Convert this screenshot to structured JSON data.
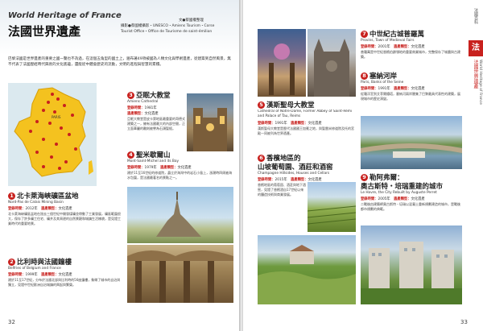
{
  "left": {
    "en_title": "World Heritage of France",
    "zh_title": "法國世界遺產",
    "credit_line1": "文●蔡國權整理",
    "credit_line2": "攝影●蔡國權攝影・UNESCO・Amiens Tourism・Corse",
    "credit_line3": "Tourist Office・Office de Tourisme de saint-émilion",
    "intro": "巴黎法國是世界遺產的重要之國一覽也不為過，在這個五角型的國土上，遍布著49項被國為人類文化與學術遺產，從建築到自然風景，無不代表了法國歷經時代興衰的文化底蘊，還能從中體會歷史的流動，文明的進程與智慧的累積。",
    "items": [
      {
        "num": "1",
        "zh": "北卡萊海峽礦區盆地",
        "en": "Nord-Pas de Calais Mining Basin",
        "year_label": "登錄時間：",
        "year": "2012年",
        "type_label": "遺產類型：",
        "type": "文化遺產",
        "text": "北卡萊海峽礦區盆地在過去三個世紀中開發煤礦並帶動了工業發展，礦區範圍很大，保存了許多礦工住宅、礦井及其周邊的自然景觀和城鎮生活樣貌，是見證工業時代的重要地景。"
      },
      {
        "num": "2",
        "zh": "比利時與法國鐘樓",
        "en": "Belfries of Belgium and France",
        "year_label": "登錄時間：",
        "year": "1999年",
        "type_label": "遺產類型：",
        "type": "文化遺產",
        "text": "建於11至17世紀，分布於法國北部與比利時的56座鐘樓，象徵了城市的自治與獨立，見證中世紀歐洲自治城鎮的興起與繁榮。"
      },
      {
        "num": "3",
        "zh": "亞眠大教堂",
        "en": "Amiens Cathedral",
        "year_label": "登錄時間：",
        "year": "1981年",
        "type_label": "遺產類型：",
        "type": "文化遺產",
        "text": "亞眠大教堂是皮卡第地區最重要的哥德式建築之一，擁有法國最大的內部空間，正立面華麗的雕刻被譽為石頭聖經。"
      },
      {
        "num": "4",
        "zh": "聖米歇爾山",
        "en": "Mont-Saint-Michel and its Bay",
        "year_label": "登錄時間：",
        "year": "1979年",
        "type_label": "遺產類型：",
        "type": "文化遺產",
        "text": "建於11至16世紀的修道院，矗立於海灣中的岩石小島上，漲潮時四周被海水包圍，是法國最著名的景點之一。"
      },
      {
        "num": "5",
        "zh": "漢斯聖母大教堂",
        "en": "Cathedral of Notre-Dame, Former Abbey of Saint-Rémi and Palace of Tau, Reims",
        "year_label": "登錄時間：",
        "year": "1991年",
        "type_label": "遺產類型：",
        "type": "文化遺產",
        "text": "漢斯聖母大教堂是歷代法國國王加冕之地，與聖雷米修道院及托的宮殿一同被列為世界遺產。"
      },
      {
        "num": "6",
        "zh": "香檳地區的山坡葡萄園、酒莊和酒窖",
        "zh1": "香檳地區的",
        "zh2": "山坡葡萄園、酒莊和酒窖",
        "en": "Champagne Hillsides, Houses and Cellars",
        "year_label": "登錄時間：",
        "year": "2015年",
        "type_label": "遺產類型：",
        "type": "文化遺產",
        "text": "香檳地區的葡萄園、酒莊與地下酒窖，見證了香檳酒自17世紀以來的釀造技術與商業發展。"
      },
      {
        "num": "7",
        "zh": "中世紀古城普羅萬",
        "en": "Provins, Town of Medieval Fairs",
        "year_label": "登錄時間：",
        "year": "2001年",
        "type_label": "遺產類型：",
        "type": "文化遺產",
        "text": "普羅萬是中世紀香檳伯爵領地的重要商業城市，完整保存了城牆與古建築。"
      },
      {
        "num": "8",
        "zh": "塞納河岸",
        "en": "Paris, Banks of the Seine",
        "year_label": "登錄時間：",
        "year": "1991年",
        "type_label": "遺產類型：",
        "type": "文化遺產",
        "text": "從羅浮宮到艾菲爾鐵塔，塞納河兩岸匯集了巴黎最具代表性的建築，展現城市的歷史演變。"
      },
      {
        "num": "9",
        "zh": "勒阿弗爾：奧古斯特・培瑞重建的城市",
        "zh1": "勒阿弗爾：",
        "zh2": "奧古斯特・培瑞重建的城市",
        "en": "Le Havre, the City Rebuilt by Auguste Perret",
        "year_label": "登錄時間：",
        "year": "2005年",
        "type_label": "遺產類型：",
        "type": "文化遺產",
        "text": "二戰後由建築師奧古斯特・培瑞以混凝土重新規劃建造的城市，是戰後都市規劃的典範。"
      }
    ],
    "map_label": "PARIS",
    "page_number": "32"
  },
  "right": {
    "side_tab_char": "法",
    "side_label_left": "法國百科",
    "side_label_zh": "法國世界遺產",
    "side_label_en": "World Heritage of France",
    "page_number": "33"
  }
}
